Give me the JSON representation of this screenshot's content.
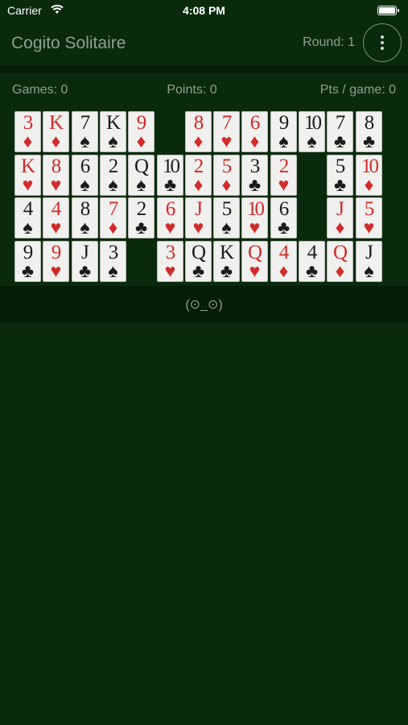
{
  "status_bar": {
    "carrier": "Carrier",
    "time": "4:08 PM"
  },
  "header": {
    "title": "Cogito Solitaire",
    "round": "Round: 1",
    "menu_icon": "vertical-ellipsis-icon"
  },
  "stats": {
    "games": "Games: 0",
    "points": "Points: 0",
    "points_per_game": "Pts / game: 0"
  },
  "board": {
    "rows": [
      [
        {
          "rank": "3",
          "suit": "♦",
          "color": "red"
        },
        {
          "rank": "K",
          "suit": "♦",
          "color": "red"
        },
        {
          "rank": "7",
          "suit": "♠",
          "color": "black"
        },
        {
          "rank": "K",
          "suit": "♠",
          "color": "black"
        },
        {
          "rank": "9",
          "suit": "♦",
          "color": "red"
        },
        null,
        {
          "rank": "8",
          "suit": "♦",
          "color": "red"
        },
        {
          "rank": "7",
          "suit": "♥",
          "color": "red"
        },
        {
          "rank": "6",
          "suit": "♦",
          "color": "red"
        },
        {
          "rank": "9",
          "suit": "♠",
          "color": "black"
        },
        {
          "rank": "10",
          "suit": "♠",
          "color": "black"
        },
        {
          "rank": "7",
          "suit": "♣",
          "color": "black"
        },
        {
          "rank": "8",
          "suit": "♣",
          "color": "black"
        }
      ],
      [
        {
          "rank": "K",
          "suit": "♥",
          "color": "red"
        },
        {
          "rank": "8",
          "suit": "♥",
          "color": "red"
        },
        {
          "rank": "6",
          "suit": "♠",
          "color": "black"
        },
        {
          "rank": "2",
          "suit": "♠",
          "color": "black"
        },
        {
          "rank": "Q",
          "suit": "♠",
          "color": "black"
        },
        {
          "rank": "10",
          "suit": "♣",
          "color": "black"
        },
        {
          "rank": "2",
          "suit": "♦",
          "color": "red"
        },
        {
          "rank": "5",
          "suit": "♦",
          "color": "red"
        },
        {
          "rank": "3",
          "suit": "♣",
          "color": "black"
        },
        {
          "rank": "2",
          "suit": "♥",
          "color": "red"
        },
        null,
        {
          "rank": "5",
          "suit": "♣",
          "color": "black"
        },
        {
          "rank": "10",
          "suit": "♦",
          "color": "red"
        }
      ],
      [
        {
          "rank": "4",
          "suit": "♠",
          "color": "black"
        },
        {
          "rank": "4",
          "suit": "♥",
          "color": "red"
        },
        {
          "rank": "8",
          "suit": "♠",
          "color": "black"
        },
        {
          "rank": "7",
          "suit": "♦",
          "color": "red"
        },
        {
          "rank": "2",
          "suit": "♣",
          "color": "black"
        },
        {
          "rank": "6",
          "suit": "♥",
          "color": "red"
        },
        {
          "rank": "J",
          "suit": "♥",
          "color": "red"
        },
        {
          "rank": "5",
          "suit": "♠",
          "color": "black"
        },
        {
          "rank": "10",
          "suit": "♥",
          "color": "red"
        },
        {
          "rank": "6",
          "suit": "♣",
          "color": "black"
        },
        null,
        {
          "rank": "J",
          "suit": "♦",
          "color": "red"
        },
        {
          "rank": "5",
          "suit": "♥",
          "color": "red"
        }
      ],
      [
        {
          "rank": "9",
          "suit": "♣",
          "color": "black"
        },
        {
          "rank": "9",
          "suit": "♥",
          "color": "red"
        },
        {
          "rank": "J",
          "suit": "♣",
          "color": "black"
        },
        {
          "rank": "3",
          "suit": "♠",
          "color": "black"
        },
        null,
        {
          "rank": "3",
          "suit": "♥",
          "color": "red"
        },
        {
          "rank": "Q",
          "suit": "♣",
          "color": "black"
        },
        {
          "rank": "K",
          "suit": "♣",
          "color": "black"
        },
        {
          "rank": "Q",
          "suit": "♥",
          "color": "red"
        },
        {
          "rank": "4",
          "suit": "♦",
          "color": "red"
        },
        {
          "rank": "4",
          "suit": "♣",
          "color": "black"
        },
        {
          "rank": "Q",
          "suit": "♦",
          "color": "red"
        },
        {
          "rank": "J",
          "suit": "♠",
          "color": "black"
        }
      ]
    ]
  },
  "footer": {
    "face": "(⊙_⊙)"
  },
  "colors": {
    "background": "#0a2a0c",
    "bar": "#061d08",
    "red_suit": "#d12b2b",
    "black_suit": "#1b1b1b",
    "muted_text": "#8fa090"
  }
}
